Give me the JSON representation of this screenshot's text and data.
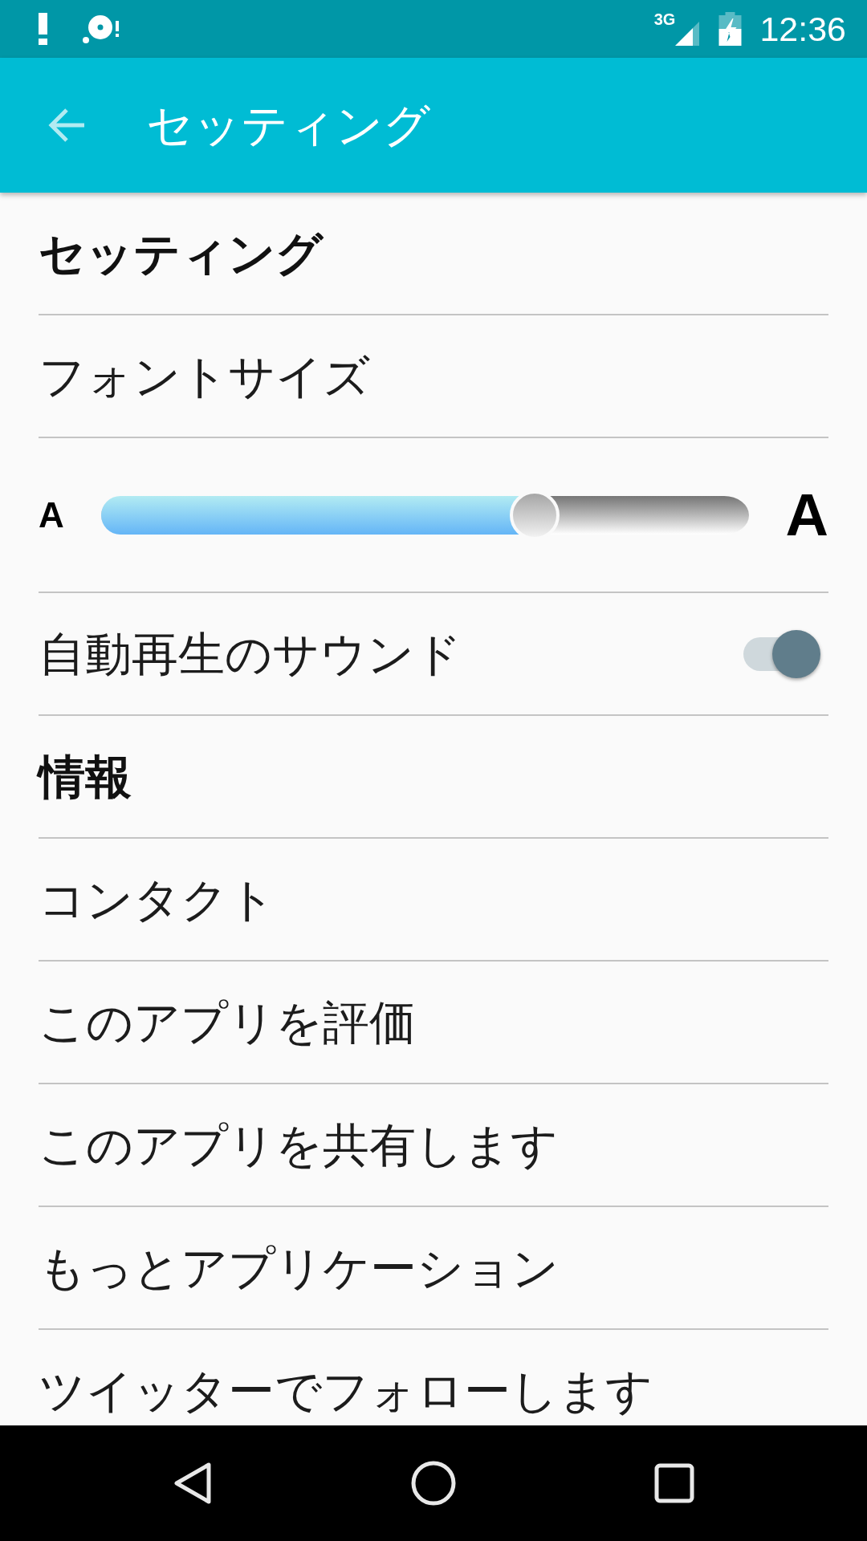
{
  "status_bar": {
    "network": "3G",
    "time": "12:36"
  },
  "app_bar": {
    "title": "セッティング"
  },
  "settings": [
    {
      "kind": "header",
      "label": "セッティング"
    },
    {
      "kind": "label",
      "label": "フォントサイズ"
    },
    {
      "kind": "slider",
      "min_label": "A",
      "max_label": "A",
      "level": 0.67
    },
    {
      "kind": "toggle",
      "label": "自動再生のサウンド",
      "on": true
    },
    {
      "kind": "header",
      "label": "情報"
    },
    {
      "kind": "item",
      "label": "コンタクト"
    },
    {
      "kind": "item",
      "label": "このアプリを評価"
    },
    {
      "kind": "item",
      "label": "このアプリを共有します"
    },
    {
      "kind": "item",
      "label": "もっとアプリケーション"
    },
    {
      "kind": "item",
      "label": "ツイッターでフォローします"
    }
  ]
}
